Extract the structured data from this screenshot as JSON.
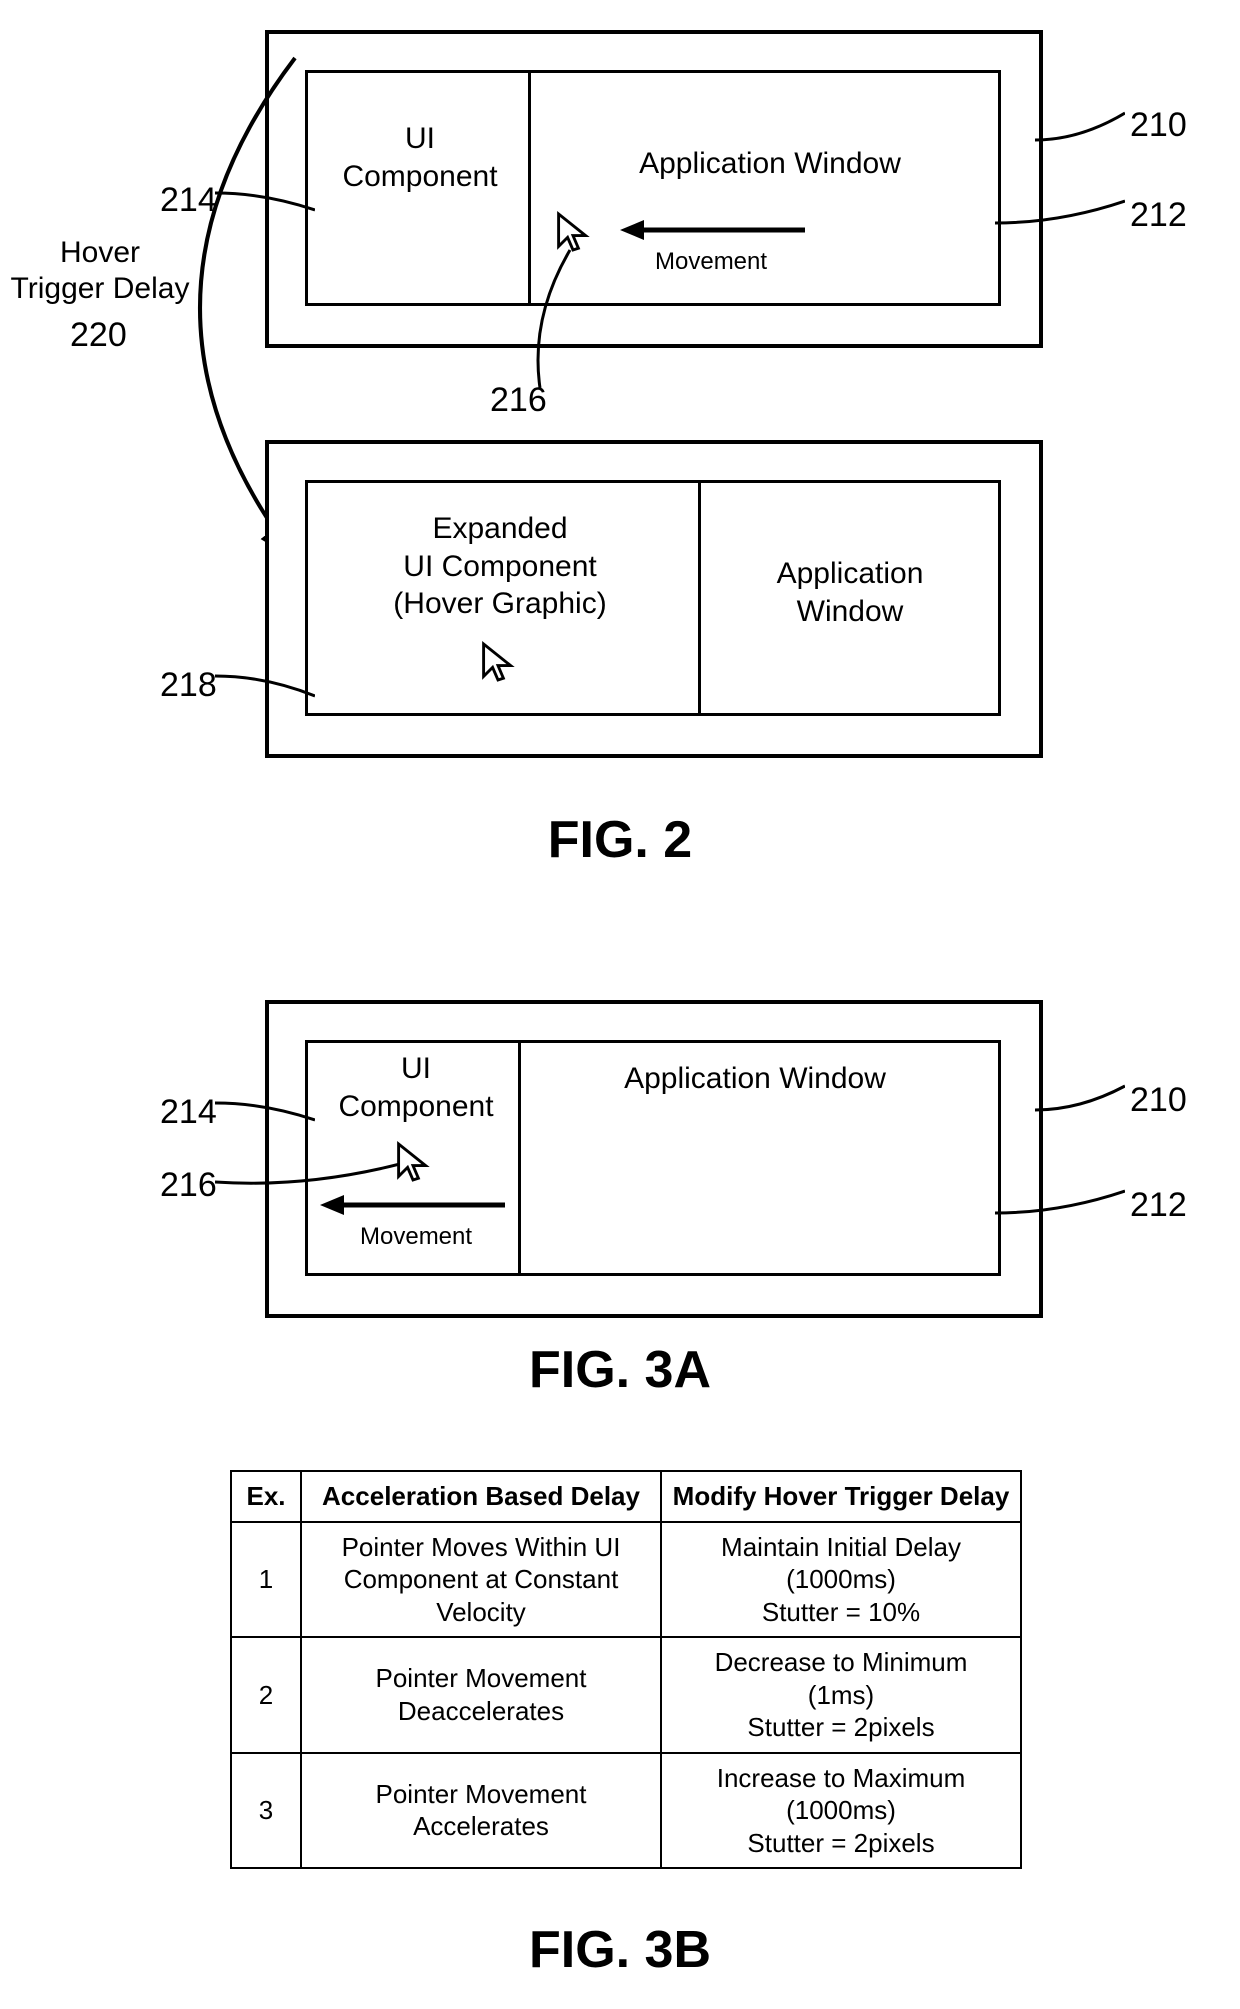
{
  "fig2": {
    "caption": "FIG. 2",
    "hover_trigger_delay_label": "Hover\nTrigger Delay",
    "hover_trigger_delay_ref": "220",
    "top": {
      "outer_ref": "210",
      "inner_ref": "212",
      "ui_component_label": "UI\nComponent",
      "ui_component_ref": "214",
      "app_window_label": "Application Window",
      "cursor_ref": "216",
      "movement_label": "Movement"
    },
    "bottom": {
      "expanded_label": "Expanded\nUI Component\n(Hover Graphic)",
      "expanded_ref": "218",
      "app_window_label": "Application\nWindow"
    }
  },
  "fig3a": {
    "caption": "FIG. 3A",
    "outer_ref": "210",
    "inner_ref": "212",
    "ui_component_label": "UI\nComponent",
    "ui_component_ref": "214",
    "app_window_label": "Application Window",
    "cursor_ref": "216",
    "movement_label": "Movement"
  },
  "fig3b": {
    "caption": "FIG. 3B",
    "headers": [
      "Ex.",
      "Acceleration Based Delay",
      "Modify Hover Trigger Delay"
    ],
    "rows": [
      {
        "ex": "1",
        "accel": "Pointer Moves Within UI Component at Constant Velocity",
        "modify": "Maintain Initial Delay\n(1000ms)\nStutter = 10%"
      },
      {
        "ex": "2",
        "accel": "Pointer Movement Deaccelerates",
        "modify": "Decrease to Minimum\n(1ms)\nStutter = 2pixels"
      },
      {
        "ex": "3",
        "accel": "Pointer Movement Accelerates",
        "modify": "Increase to Maximum\n(1000ms)\nStutter = 2pixels"
      }
    ]
  }
}
